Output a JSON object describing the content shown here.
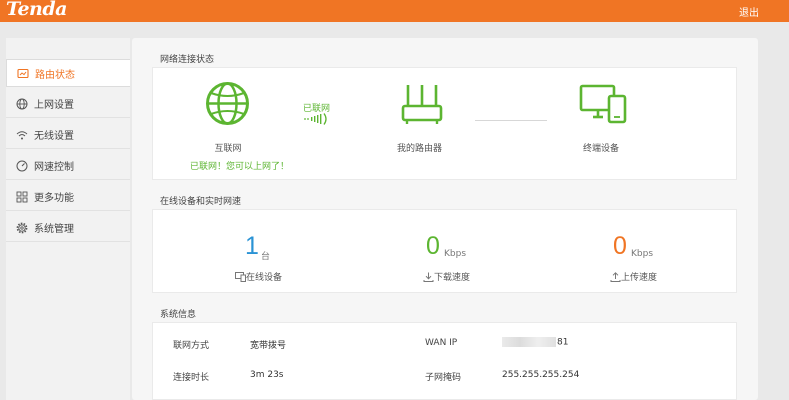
{
  "header": {
    "logo": "Tenda",
    "logout": "退出"
  },
  "sidebar": {
    "items": [
      {
        "label": "路由状态",
        "icon": "monitor-icon",
        "active": true
      },
      {
        "label": "上网设置",
        "icon": "globe-icon",
        "active": false
      },
      {
        "label": "无线设置",
        "icon": "wifi-icon",
        "active": false
      },
      {
        "label": "网速控制",
        "icon": "gauge-icon",
        "active": false
      },
      {
        "label": "更多功能",
        "icon": "grid-icon",
        "active": false
      },
      {
        "label": "系统管理",
        "icon": "gear-icon",
        "active": false
      }
    ]
  },
  "network": {
    "title": "网络连接状态",
    "internet_label": "互联网",
    "internet_status": "已联网！您可以上网了！",
    "link_status": "已联网",
    "router_label": "我的路由器",
    "terminal_label": "终端设备"
  },
  "realtime": {
    "title": "在线设备和实时网速",
    "online": {
      "value": "1",
      "unit": "台",
      "label": "在线设备"
    },
    "download": {
      "value": "0",
      "unit": "Kbps",
      "label": "下载速度"
    },
    "upload": {
      "value": "0",
      "unit": "Kbps",
      "label": "上传速度"
    }
  },
  "sysinfo": {
    "title": "系统信息",
    "rows": [
      {
        "label": "联网方式",
        "value": "宽带拨号",
        "label2": "WAN IP",
        "value2": "81"
      },
      {
        "label": "连接时长",
        "value": "3m 23s",
        "label2": "子网掩码",
        "value2": "255.255.255.254"
      }
    ]
  },
  "colors": {
    "brand": "#f07524",
    "green": "#5cb531",
    "blue": "#2a93d5",
    "orange": "#f07524"
  }
}
